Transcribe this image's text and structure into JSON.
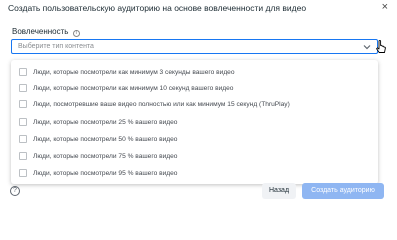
{
  "dialog": {
    "title": "Создать пользовательскую аудиторию на основе вовлеченности для видео",
    "close_glyph": "×"
  },
  "field": {
    "label": "Вовлеченность",
    "info_glyph": "i",
    "placeholder": "Выберите тип контента"
  },
  "options": [
    {
      "label": "Люди, которые посмотрели как минимум 3 секунды вашего видео"
    },
    {
      "label": "Люди, которые посмотрели как минимум 10 секунд вашего видео"
    },
    {
      "label": "Люди, посмотревшие ваше видео полностью или как минимум 15 секунд (ThruPlay)"
    },
    {
      "label": "Люди, которые посмотрели 25 % вашего видео"
    },
    {
      "label": "Люди, которые посмотрели 50 % вашего видео"
    },
    {
      "label": "Люди, которые посмотрели 75 % вашего видео"
    },
    {
      "label": "Люди, которые посмотрели 95 % вашего видео"
    }
  ],
  "footer": {
    "help_glyph": "?",
    "back_label": "Назад",
    "create_label": "Создать аудиторию"
  },
  "colors": {
    "accent": "#1877f2",
    "create_disabled": "#8fb6f2",
    "back_bg": "#f0f2f5"
  },
  "icons": {
    "close": "close-icon",
    "info": "info-icon",
    "caret": "chevron-down-icon",
    "cursor": "mouse-pointer-icon",
    "help": "help-icon"
  }
}
